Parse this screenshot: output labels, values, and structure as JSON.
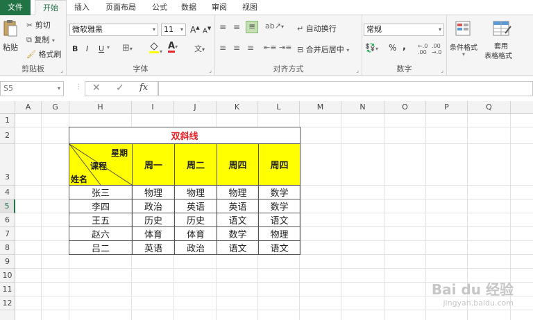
{
  "tabs": [
    "文件",
    "开始",
    "插入",
    "页面布局",
    "公式",
    "数据",
    "审阅",
    "视图"
  ],
  "ribbon": {
    "clipboard": {
      "paste": "粘贴",
      "cut": "剪切",
      "copy": "复制",
      "format_painter": "格式刷",
      "label": "剪贴板"
    },
    "font": {
      "font_name": "微软雅黑",
      "font_size": "11",
      "bold": "B",
      "italic": "I",
      "underline": "U",
      "label": "字体",
      "grow": "A",
      "shrink": "A",
      "phonetic": "文"
    },
    "alignment": {
      "wrap_text": "自动换行",
      "merge_center": "合并后居中",
      "label": "对齐方式"
    },
    "number": {
      "format": "常规",
      "percent": "%",
      "comma": ",",
      "label": "数字"
    },
    "styles": {
      "conditional": "条件格式",
      "table_format_1": "套用",
      "table_format_2": "表格格式"
    }
  },
  "formula_bar": {
    "name_box": "S5",
    "fx": "fx",
    "cancel": "✕",
    "enter": "✓"
  },
  "columns": [
    "A",
    "G",
    "H",
    "I",
    "J",
    "K",
    "L",
    "M",
    "N",
    "O",
    "P",
    "Q"
  ],
  "rows": [
    "1",
    "2",
    "3",
    "4",
    "5",
    "6",
    "7",
    "8",
    "9",
    "10",
    "11",
    "12"
  ],
  "sheet_table": {
    "title": "双斜线",
    "header_top": "星期",
    "header_mid": "课程",
    "header_bottom": "姓名",
    "days": [
      "周一",
      "周二",
      "周四",
      "周四"
    ],
    "rows": [
      [
        "张三",
        "物理",
        "物理",
        "物理",
        "数学"
      ],
      [
        "李四",
        "政治",
        "英语",
        "英语",
        "数学"
      ],
      [
        "王五",
        "历史",
        "历史",
        "语文",
        "语文"
      ],
      [
        "赵六",
        "体育",
        "体育",
        "数学",
        "物理"
      ],
      [
        "吕二",
        "英语",
        "政治",
        "语文",
        "语文"
      ]
    ]
  },
  "colors": {
    "excel_green": "#217346",
    "title_red": "#e8242b",
    "header_yellow": "#ffff00"
  },
  "watermark": {
    "brand": "Bai du 经验",
    "url": "jingyan.baidu.com"
  }
}
